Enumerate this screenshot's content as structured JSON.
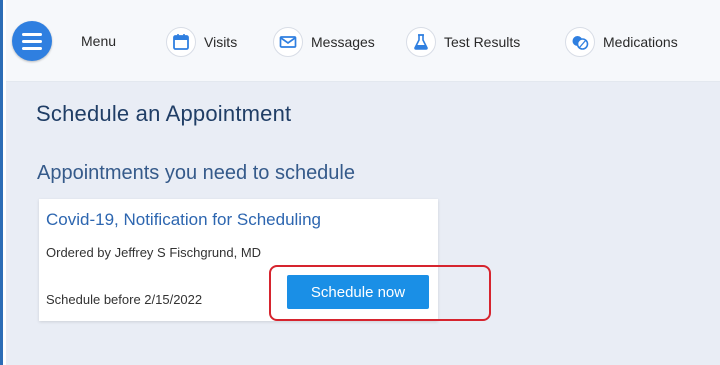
{
  "nav": {
    "menu_label": "Menu",
    "items": [
      {
        "label": "Visits",
        "icon": "calendar-icon"
      },
      {
        "label": "Messages",
        "icon": "envelope-icon"
      },
      {
        "label": "Test Results",
        "icon": "flask-icon"
      },
      {
        "label": "Medications",
        "icon": "pill-icon"
      }
    ]
  },
  "page": {
    "title": "Schedule an Appointment",
    "section_title": "Appointments you need to schedule"
  },
  "appointment": {
    "title": "Covid-19, Notification for Scheduling",
    "ordered_by": "Ordered by Jeffrey S Fischgrund, MD",
    "deadline": "Schedule before 2/15/2022",
    "button_label": "Schedule now"
  },
  "colors": {
    "brand_blue": "#2f7fe0",
    "button_blue": "#1a8fe6",
    "highlight_red": "#d6242e"
  }
}
